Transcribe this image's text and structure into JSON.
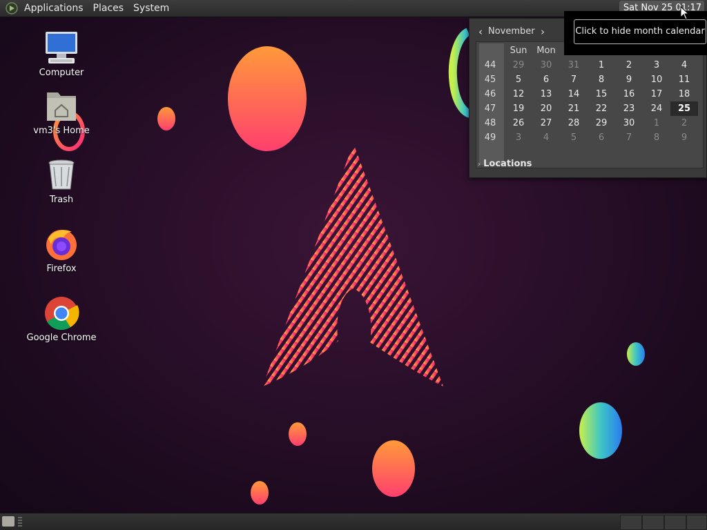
{
  "top_panel": {
    "menus": [
      "Applications",
      "Places",
      "System"
    ],
    "clock": "Sat Nov 25  01:17"
  },
  "desktop_icons": [
    {
      "label": "Computer",
      "icon": "computer-icon"
    },
    {
      "label": "vm3's Home",
      "icon": "home-folder-icon"
    },
    {
      "label": "Trash",
      "icon": "trash-icon"
    },
    {
      "label": "Firefox",
      "icon": "firefox-icon"
    },
    {
      "label": "Google Chrome",
      "icon": "chrome-icon"
    }
  ],
  "calendar": {
    "month": "November",
    "prev_glyph": "‹",
    "next_glyph": "›",
    "day_headers": [
      "Sun",
      "Mon"
    ],
    "weeks": [
      {
        "num": "44",
        "days": [
          "29",
          "30",
          "31",
          "1",
          "2",
          "3",
          "4"
        ],
        "dim": [
          true,
          true,
          true,
          false,
          false,
          false,
          false
        ]
      },
      {
        "num": "45",
        "days": [
          "5",
          "6",
          "7",
          "8",
          "9",
          "10",
          "11"
        ],
        "dim": [
          false,
          false,
          false,
          false,
          false,
          false,
          false
        ]
      },
      {
        "num": "46",
        "days": [
          "12",
          "13",
          "14",
          "15",
          "16",
          "17",
          "18"
        ],
        "dim": [
          false,
          false,
          false,
          false,
          false,
          false,
          false
        ]
      },
      {
        "num": "47",
        "days": [
          "19",
          "20",
          "21",
          "22",
          "23",
          "24",
          "25"
        ],
        "dim": [
          false,
          false,
          false,
          false,
          false,
          false,
          false
        ]
      },
      {
        "num": "48",
        "days": [
          "26",
          "27",
          "28",
          "29",
          "30",
          "1",
          "2"
        ],
        "dim": [
          false,
          false,
          false,
          false,
          false,
          true,
          true
        ]
      },
      {
        "num": "49",
        "days": [
          "3",
          "4",
          "5",
          "6",
          "7",
          "8",
          "9"
        ],
        "dim": [
          true,
          true,
          true,
          true,
          true,
          true,
          true
        ]
      }
    ],
    "today": "25",
    "locations_label": "Locations",
    "locations_glyph": "›"
  },
  "tooltip": "Click to hide month calendar",
  "colors": {
    "panel_bg": "#2b2b2b",
    "desktop_bg": "#2a0f2a",
    "calendar_bg": "#3a3a3a",
    "accent_pink": "#ff2a78",
    "accent_orange": "#ff9a3c"
  }
}
